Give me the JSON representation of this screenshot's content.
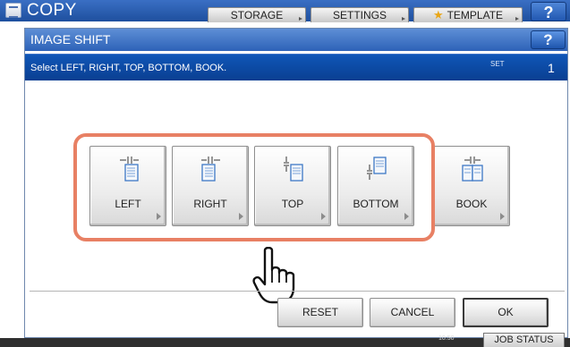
{
  "app": {
    "title": "COPY",
    "tabs": [
      {
        "label": "STORAGE"
      },
      {
        "label": "SETTINGS"
      },
      {
        "label": "TEMPLATE"
      }
    ],
    "help_label": "?"
  },
  "dialog": {
    "title": "IMAGE SHIFT",
    "help_label": "?",
    "message": "Select LEFT, RIGHT, TOP, BOTTOM, BOOK.",
    "set_label": "SET",
    "set_count": "1",
    "options": [
      {
        "label": "LEFT",
        "icon": "left-shift-icon"
      },
      {
        "label": "RIGHT",
        "icon": "right-shift-icon"
      },
      {
        "label": "TOP",
        "icon": "top-shift-icon"
      },
      {
        "label": "BOTTOM",
        "icon": "bottom-shift-icon"
      },
      {
        "label": "BOOK",
        "icon": "book-shift-icon"
      }
    ],
    "actions": {
      "reset": "RESET",
      "cancel": "CANCEL",
      "ok": "OK"
    }
  },
  "status": {
    "time": "10:50",
    "job_status_label": "JOB STATUS"
  },
  "colors": {
    "title_bar": "#2d62b8",
    "message_bar": "#0a3f91",
    "highlight": "#e88064"
  }
}
